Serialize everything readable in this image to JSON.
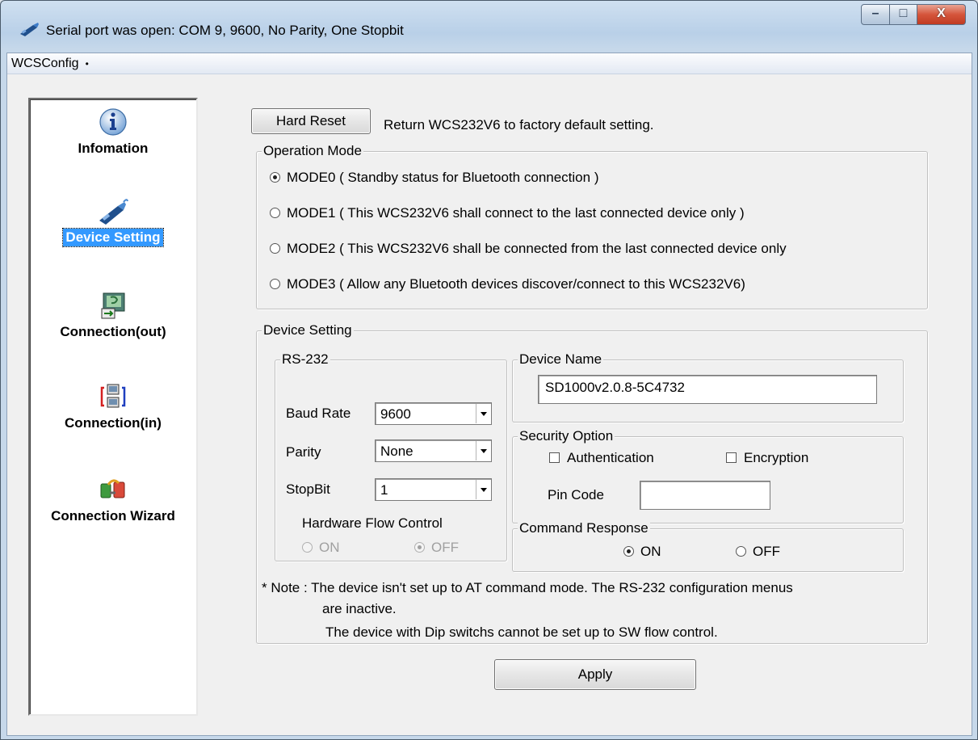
{
  "window": {
    "title": "Serial port was open: COM 9, 9600, No Parity, One Stopbit",
    "minimize_glyph": "–",
    "maximize_glyph": "□",
    "close_glyph": "X"
  },
  "menubar": {
    "items": [
      {
        "label": "WCSConfig",
        "dot": "•"
      }
    ]
  },
  "sidebar": {
    "items": [
      {
        "label": "Infomation",
        "icon": "info-icon",
        "selected": false
      },
      {
        "label": "Device Setting",
        "icon": "device-adapter-icon",
        "selected": true
      },
      {
        "label": "Connection(out)",
        "icon": "connection-out-icon",
        "selected": false
      },
      {
        "label": "Connection(in)",
        "icon": "connection-in-icon",
        "selected": false
      },
      {
        "label": "Connection Wizard",
        "icon": "connection-wizard-icon",
        "selected": false
      }
    ]
  },
  "hard_reset": {
    "button_label": "Hard Reset",
    "description": "Return WCS232V6 to factory default setting."
  },
  "operation_mode": {
    "legend": "Operation Mode",
    "options": [
      {
        "label": "MODE0 ( Standby status for Bluetooth connection )",
        "checked": true
      },
      {
        "label": "MODE1 ( This WCS232V6 shall connect to the last connected device only )",
        "checked": false
      },
      {
        "label": "MODE2 ( This WCS232V6 shall be connected from the last connected device only",
        "checked": false
      },
      {
        "label": "MODE3 ( Allow any Bluetooth devices discover/connect to this WCS232V6)",
        "checked": false
      }
    ]
  },
  "device_setting": {
    "legend": "Device Setting",
    "rs232": {
      "legend": "RS-232",
      "baud_rate": {
        "label": "Baud Rate",
        "value": "9600"
      },
      "parity": {
        "label": "Parity",
        "value": "None"
      },
      "stopbit": {
        "label": "StopBit",
        "value": "1"
      },
      "flow_control": {
        "label": "Hardware Flow Control",
        "on_label": "ON",
        "off_label": "OFF",
        "selected": "OFF",
        "enabled": false
      }
    },
    "device_name": {
      "legend": "Device Name",
      "value": "SD1000v2.0.8-5C4732"
    },
    "security": {
      "legend": "Security Option",
      "authentication": {
        "label": "Authentication",
        "checked": false
      },
      "encryption": {
        "label": "Encryption",
        "checked": false
      },
      "pin_code": {
        "label": "Pin Code",
        "value": ""
      }
    },
    "command_response": {
      "legend": "Command Response",
      "on_label": "ON",
      "off_label": "OFF",
      "selected": "ON"
    },
    "note_line1": "* Note : The device isn't set up to AT command mode. The RS-232 configuration menus",
    "note_line2": "are inactive.",
    "note_line3": "The device with Dip switchs cannot be set up to SW flow control."
  },
  "apply_button": {
    "label": "Apply"
  },
  "colors": {
    "selection": "#3399ff",
    "dialog_bg": "#f0f0f0",
    "close_button": "#c8442a"
  }
}
